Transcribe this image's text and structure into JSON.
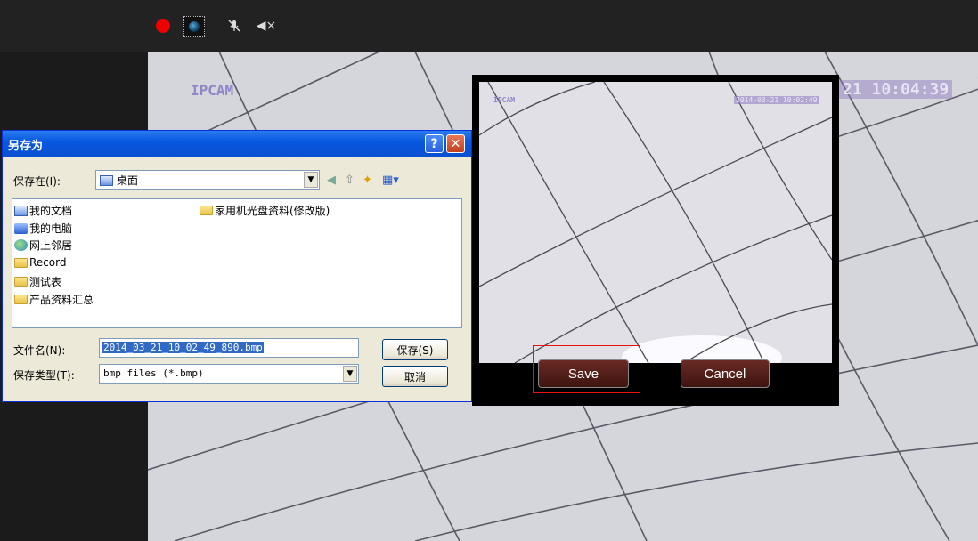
{
  "toolbar": {
    "icons": [
      "record-icon",
      "snapshot-camera-icon",
      "mic-muted-icon",
      "speaker-muted-icon"
    ],
    "speaker_glyph": "◀×",
    "mic_glyph": "✕"
  },
  "video": {
    "osd_name": "IPCAM",
    "osd_time": "21 10:04:39"
  },
  "preview": {
    "osd_name": "IPCAM",
    "osd_time": "2014-03-21 10:02:49",
    "save_label": "Save",
    "cancel_label": "Cancel"
  },
  "dialog": {
    "title": "另存为",
    "help_glyph": "?",
    "close_glyph": "✕",
    "save_in_label": "保存在(I):",
    "save_in_value": "桌面",
    "files": [
      {
        "name": "我的文档",
        "icon": "document-folder-icon"
      },
      {
        "name": "我的电脑",
        "icon": "computer-icon"
      },
      {
        "name": "网上邻居",
        "icon": "network-icon"
      },
      {
        "name": "Record",
        "icon": "folder-icon"
      },
      {
        "name": "测试表",
        "icon": "folder-icon"
      },
      {
        "name": "产品资料汇总",
        "icon": "folder-icon"
      },
      {
        "name": "家用机光盘资料(修改版)",
        "icon": "folder-icon"
      }
    ],
    "filename_label": "文件名(N):",
    "filename_value": "2014_03_21_10_02_49_890.bmp",
    "filetype_label": "保存类型(T):",
    "filetype_value": "bmp files (*.bmp)",
    "save_button": "保存(S)",
    "cancel_button": "取消"
  }
}
